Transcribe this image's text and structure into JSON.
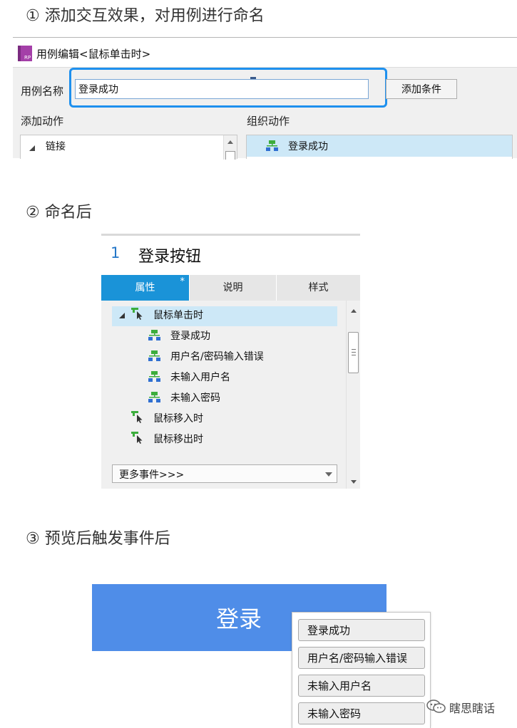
{
  "steps": {
    "step1": "① 添加交互效果，对用例进行命名",
    "step2": "② 命名后",
    "step3": "③ 预览后触发事件后"
  },
  "case_editor": {
    "app_icon_text": "RP",
    "window_title": "用例编辑<鼠标单击时>",
    "case_name_label": "用例名称",
    "case_name_value": "登录成功",
    "add_condition_label": "添加条件",
    "add_actions_label": "添加动作",
    "organize_actions_label": "组织动作",
    "action_tree": [
      "链接"
    ],
    "organized_cases": [
      "登录成功"
    ]
  },
  "interactions_panel": {
    "widget_number": "1",
    "widget_name": "登录按钮",
    "tabs": [
      {
        "label": "属性",
        "active": true,
        "modified": true
      },
      {
        "label": "说明",
        "active": false
      },
      {
        "label": "样式",
        "active": false
      }
    ],
    "modified_marker": "*",
    "events": [
      {
        "label": "鼠标单击时",
        "expanded": true,
        "cases": [
          "登录成功",
          "用户名/密码输入错误",
          "未输入用户名",
          "未输入密码"
        ]
      },
      {
        "label": "鼠标移入时"
      },
      {
        "label": "鼠标移出时"
      }
    ],
    "more_events_label": "更多事件>>>"
  },
  "preview": {
    "login_button_label": "登录",
    "case_menu": [
      "登录成功",
      "用户名/密码输入错误",
      "未输入用户名",
      "未输入密码"
    ]
  },
  "watermark": {
    "icon": "wechat-icon",
    "text": "瞎思瞎话"
  },
  "colors": {
    "accent_blue": "#1a93d8",
    "focus_ring": "#1e90ee",
    "selection": "#cde8f7",
    "login_button": "#4f8de8",
    "case_icon_green": "#3cad3c",
    "rp_icon_purple": "#a43fa8"
  }
}
